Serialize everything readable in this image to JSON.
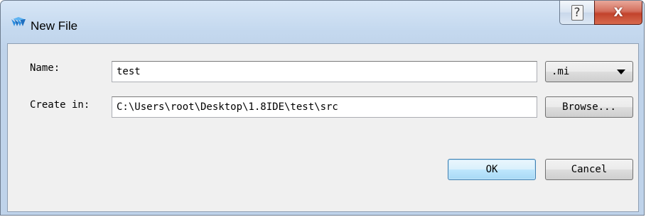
{
  "window": {
    "title": "New File",
    "help_glyph": "?",
    "close_glyph": "X"
  },
  "form": {
    "name_label": "Name:",
    "name_value": "test",
    "extension_selected": ".mi",
    "create_in_label": "Create in:",
    "create_in_value": "C:\\Users\\root\\Desktop\\1.8IDE\\test\\src",
    "browse_label": "Browse...",
    "ok_label": "OK",
    "cancel_label": "Cancel"
  },
  "icons": {
    "app": "gowin-logo-icon",
    "help": "help-icon",
    "close": "close-icon",
    "dropdown": "chevron-down-icon"
  },
  "colors": {
    "title_bar": "#c5d9ef",
    "close_button": "#c2432c",
    "default_button": "#a7d9f5",
    "client_background": "#f0f0f0"
  }
}
